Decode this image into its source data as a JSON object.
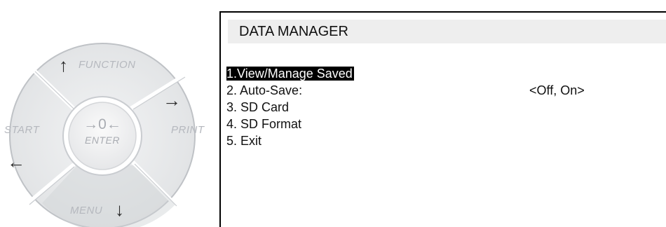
{
  "keypad": {
    "function_label": "FUNCTION",
    "print_label": "PRINT",
    "menu_label": "MENU",
    "start_label": "START",
    "enter_symbol": "→0←",
    "enter_label": "ENTER",
    "up_arrow": "↑",
    "right_arrow": "→",
    "left_arrow": "←",
    "down_arrow": "↓"
  },
  "screen": {
    "title": "DATA MANAGER",
    "items": [
      {
        "label": "1.View/Manage Saved",
        "selected": true
      },
      {
        "label": "2. Auto-Save:",
        "selected": false
      },
      {
        "label": "3. SD Card",
        "selected": false
      },
      {
        "label": "4. SD Format",
        "selected": false
      },
      {
        "label": "5. Exit",
        "selected": false
      }
    ],
    "autosave_options": "<Off, On>"
  }
}
